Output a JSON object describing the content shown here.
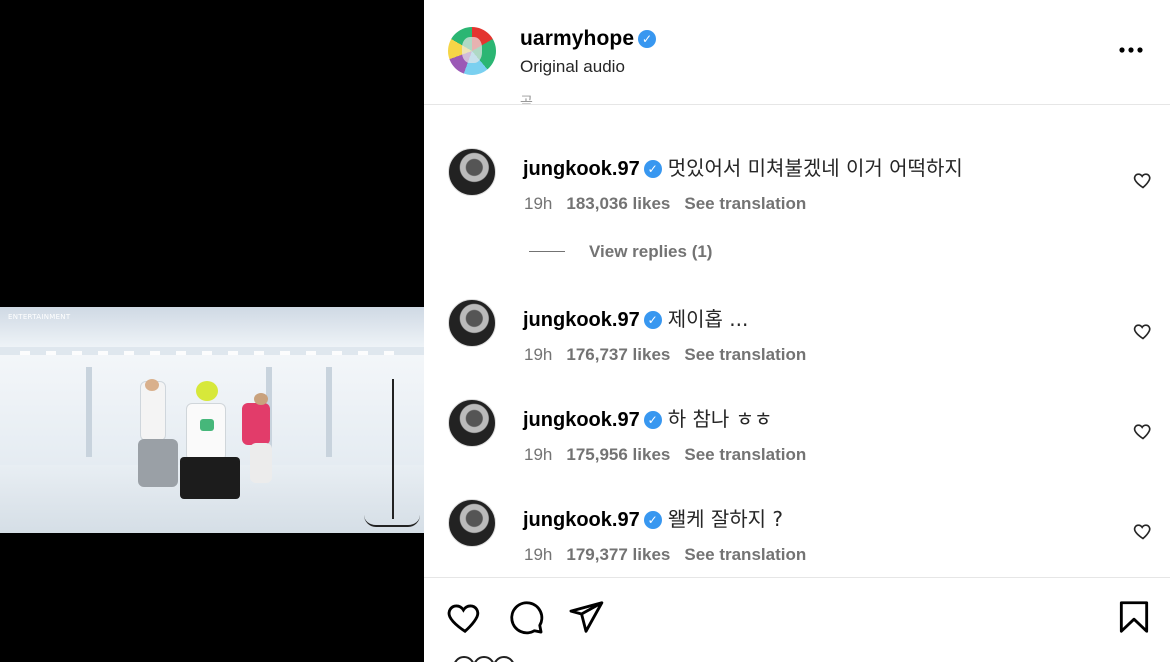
{
  "post": {
    "owner": "uarmyhope",
    "verified_mark": "✓",
    "audio": "Original audio",
    "more_icon": "more-horizontal-icon",
    "clipped_caption_fragment": "곰"
  },
  "video": {
    "brand_text": "ENTERTAINMENT"
  },
  "comments": [
    {
      "user": "jungkook.97",
      "text": "멋있어서 미쳐불겠네 이거 어떡하지",
      "time": "19h",
      "likes": "183,036 likes",
      "translate": "See translation"
    },
    {
      "user": "jungkook.97",
      "text": "제이홉 ...",
      "time": "19h",
      "likes": "176,737 likes",
      "translate": "See translation"
    },
    {
      "user": "jungkook.97",
      "text": "하 참나 ㅎㅎ",
      "time": "19h",
      "likes": "175,956 likes",
      "translate": "See translation"
    },
    {
      "user": "jungkook.97",
      "text": "왤케 잘하지 ?",
      "time": "19h",
      "likes": "179,377 likes",
      "translate": "See translation"
    }
  ],
  "replies": {
    "label": "View replies (1)"
  },
  "actions": {
    "like_icon": "heart-icon",
    "comment_icon": "comment-icon",
    "share_icon": "send-icon",
    "save_icon": "bookmark-icon"
  },
  "colors": {
    "verified": "#3897f0",
    "muted_text": "#737373",
    "border": "#e6e6e6"
  }
}
